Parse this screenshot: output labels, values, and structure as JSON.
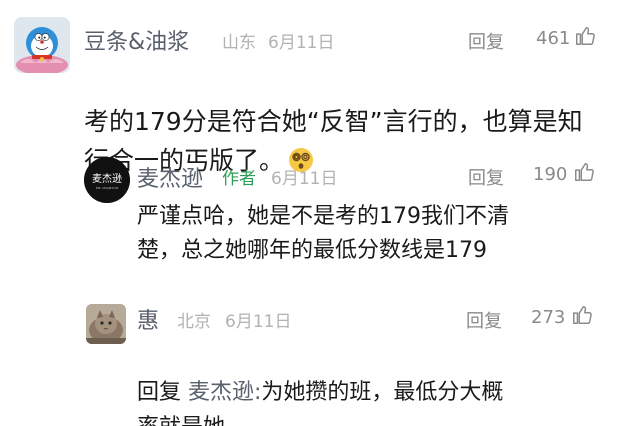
{
  "comments": [
    {
      "username": "豆条&油浆",
      "location": "山东",
      "date": "6月11日",
      "reply_label": "回复",
      "likes": "461",
      "text": "考的179分是符合她“反智”言行的，也算是知\n行合一的丐版了。",
      "emoji": "dizzy-face-emoji"
    },
    {
      "username": "麦杰逊",
      "author_tag": "作者",
      "date": "6月11日",
      "reply_label": "回复",
      "likes": "190",
      "avatar_text": "麦杰逊",
      "avatar_subtext": "MR. MAIJIEXUN",
      "text": "严谨点哈，她是不是考的179我们不清\n楚，总之她哪年的最低分数线是179"
    },
    {
      "username": "惠",
      "location": "北京",
      "date": "6月11日",
      "reply_label": "回复",
      "likes": "273",
      "reply_prefix": "回复 ",
      "reply_target": "麦杰逊:",
      "text": "为她攒的班，最低分大概\n率就是她"
    }
  ],
  "colors": {
    "name": "#58606e",
    "author_tag": "#2e9e58",
    "meta": "#b2b2b2",
    "body": "#1a1a1a"
  }
}
